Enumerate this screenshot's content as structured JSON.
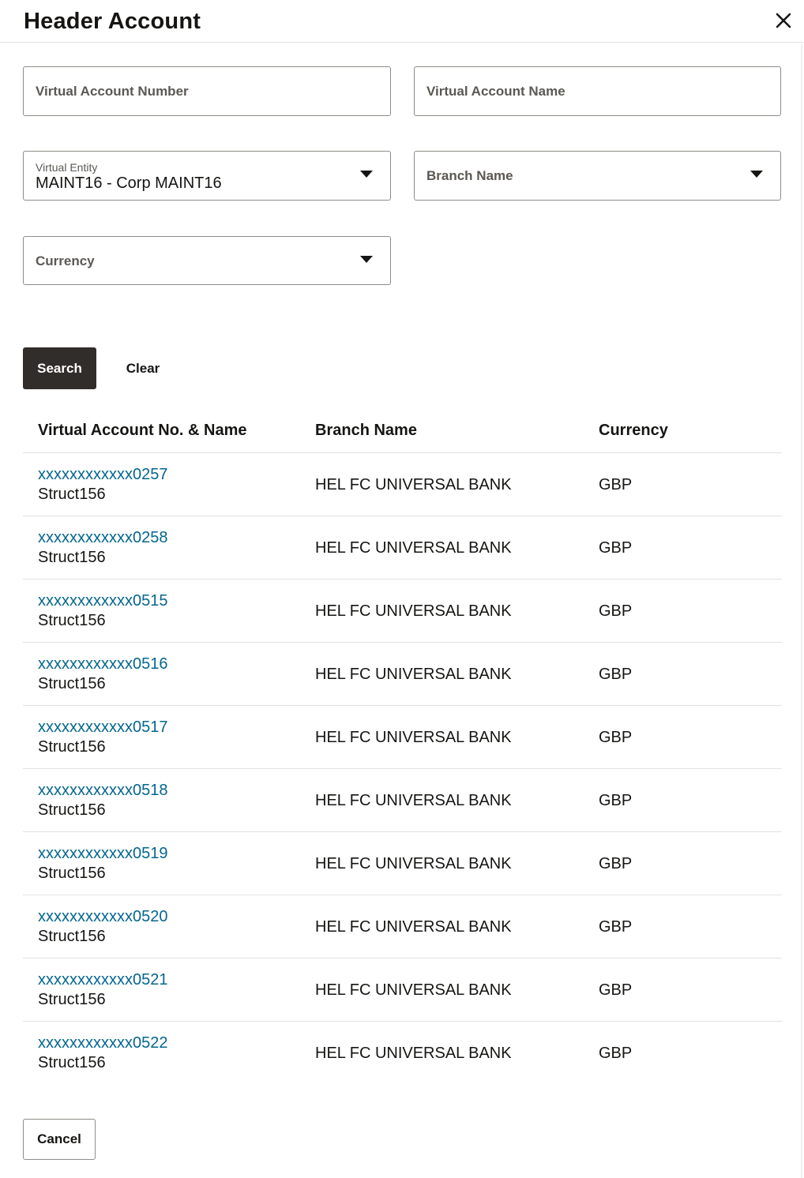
{
  "header": {
    "title": "Header Account",
    "close_icon": "close-icon"
  },
  "form": {
    "virtual_account_number": {
      "placeholder": "Virtual Account Number",
      "value": ""
    },
    "virtual_account_name": {
      "placeholder": "Virtual Account Name",
      "value": ""
    },
    "virtual_entity": {
      "label": "Virtual Entity",
      "value": "MAINT16 - Corp MAINT16"
    },
    "branch_name": {
      "placeholder": "Branch Name",
      "value": ""
    },
    "currency": {
      "placeholder": "Currency",
      "value": ""
    }
  },
  "actions": {
    "search_label": "Search",
    "clear_label": "Clear",
    "cancel_label": "Cancel"
  },
  "table": {
    "columns": [
      "Virtual Account No. & Name",
      "Branch Name",
      "Currency"
    ],
    "rows": [
      {
        "account_no": "xxxxxxxxxxxx0257",
        "account_name": "Struct156",
        "branch": "HEL FC UNIVERSAL BANK",
        "currency": "GBP"
      },
      {
        "account_no": "xxxxxxxxxxxx0258",
        "account_name": "Struct156",
        "branch": "HEL FC UNIVERSAL BANK",
        "currency": "GBP"
      },
      {
        "account_no": "xxxxxxxxxxxx0515",
        "account_name": "Struct156",
        "branch": "HEL FC UNIVERSAL BANK",
        "currency": "GBP"
      },
      {
        "account_no": "xxxxxxxxxxxx0516",
        "account_name": "Struct156",
        "branch": "HEL FC UNIVERSAL BANK",
        "currency": "GBP"
      },
      {
        "account_no": "xxxxxxxxxxxx0517",
        "account_name": "Struct156",
        "branch": "HEL FC UNIVERSAL BANK",
        "currency": "GBP"
      },
      {
        "account_no": "xxxxxxxxxxxx0518",
        "account_name": "Struct156",
        "branch": "HEL FC UNIVERSAL BANK",
        "currency": "GBP"
      },
      {
        "account_no": "xxxxxxxxxxxx0519",
        "account_name": "Struct156",
        "branch": "HEL FC UNIVERSAL BANK",
        "currency": "GBP"
      },
      {
        "account_no": "xxxxxxxxxxxx0520",
        "account_name": "Struct156",
        "branch": "HEL FC UNIVERSAL BANK",
        "currency": "GBP"
      },
      {
        "account_no": "xxxxxxxxxxxx0521",
        "account_name": "Struct156",
        "branch": "HEL FC UNIVERSAL BANK",
        "currency": "GBP"
      },
      {
        "account_no": "xxxxxxxxxxxx0522",
        "account_name": "Struct156",
        "branch": "HEL FC UNIVERSAL BANK",
        "currency": "GBP"
      }
    ]
  },
  "colors": {
    "link": "#04668f",
    "primary_button": "#312d2a",
    "border": "#8f8c88",
    "divider": "#e4e2df"
  }
}
